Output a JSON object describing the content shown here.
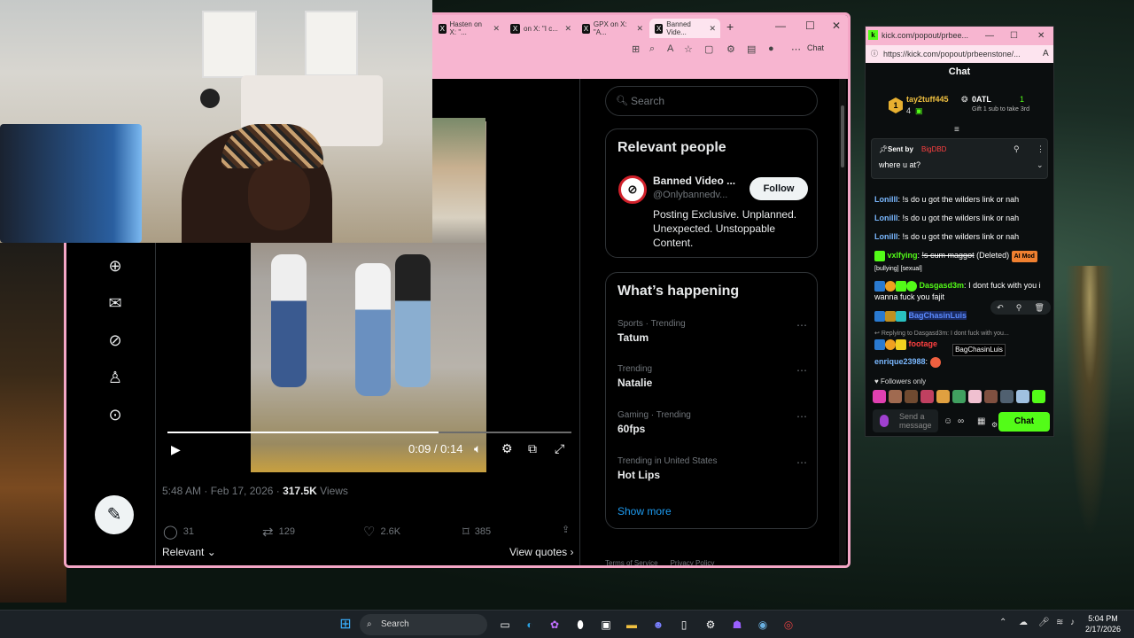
{
  "browser": {
    "tabs": [
      {
        "label": "Hasten on X: \"...",
        "active": false
      },
      {
        "label": "on X: \"I c...",
        "active": false
      },
      {
        "label": "GPX on X: \"A...",
        "active": false
      },
      {
        "label": "Banned Vide...",
        "active": true
      }
    ],
    "new_tab": "+",
    "copilot_label": "Chat"
  },
  "tweet": {
    "video": {
      "current": "0:09",
      "duration": "0:14",
      "time_text": "0:09 / 0:14",
      "progress_fraction": 0.67
    },
    "timestamp": "5:48 AM · Feb 17, 2026 · ",
    "views_count": "317.5K",
    "views_label": " Views",
    "stats": {
      "replies": "31",
      "reposts": "129",
      "likes": "2.6K",
      "bookmarks": "385"
    },
    "sort_label": "Relevant",
    "view_quotes": "View quotes"
  },
  "sidebar": {
    "search_placeholder": "Search",
    "relevant_people": {
      "title": "Relevant people",
      "name": "Banned Video ...",
      "handle": "@Onlybannedv...",
      "follow": "Follow",
      "bio": "Posting Exclusive. Unplanned. Unexpected. Unstoppable Content."
    },
    "happening": {
      "title": "What’s happening",
      "trends": [
        {
          "category": "Sports · Trending",
          "name": "Tatum"
        },
        {
          "category": "Trending",
          "name": "Natalie"
        },
        {
          "category": "Gaming · Trending",
          "name": "60fps"
        },
        {
          "category": "Trending in United States",
          "name": "Hot Lips"
        }
      ],
      "show_more": "Show more"
    },
    "footer": [
      "Terms of Service",
      "Privacy Policy"
    ]
  },
  "kick": {
    "window_title": "kick.com/popout/prbee...",
    "url": "https://kick.com/popout/prbeenstone/...",
    "header": "Chat",
    "leaderboard": [
      {
        "rank": "1",
        "name": "tay2tuff445",
        "count": "4"
      },
      {
        "name": "0ATL",
        "count": "1",
        "note": "Gift 1 sub to take 3rd"
      }
    ],
    "pinned": {
      "sent_by_label": "Sent by",
      "sent_by_user": "BigDBD",
      "text": "where u at?"
    },
    "messages": [
      {
        "user": "Lonilll",
        "text": "!s do u got the wilders link or nah"
      },
      {
        "user": "Lonilll",
        "text": "!s do u got the wilders link or nah"
      },
      {
        "user": "Lonilll",
        "text": "!s do u got the wilders link or nah"
      },
      {
        "user": "vxlfying",
        "text": "!s cum maggot",
        "deleted": "(Deleted)",
        "badge": "AI Mod",
        "tags": "[bullying] [sexual]"
      },
      {
        "user": "Dasgasd3m",
        "text": "I dont fuck with you i wanna fuck you fajit"
      },
      {
        "user": "BagChasinLuis",
        "text": ""
      },
      {
        "reply_to": "Replying to Dasgasd3m: I dont fuck with you...",
        "user": "footage",
        "text": ""
      },
      {
        "user": "enrique23988",
        "text": ""
      }
    ],
    "tooltip": "BagChasinLuis",
    "followers_only": "Followers only",
    "input_placeholder": "Send a message",
    "send_button": "Chat"
  },
  "taskbar": {
    "search": "Search",
    "time": "5:04 PM",
    "date": "2/17/2026"
  },
  "colors": {
    "kick_green": "#53fc18",
    "x_blue": "#1d9bf0",
    "browser_pink": "#f7b5d0"
  }
}
